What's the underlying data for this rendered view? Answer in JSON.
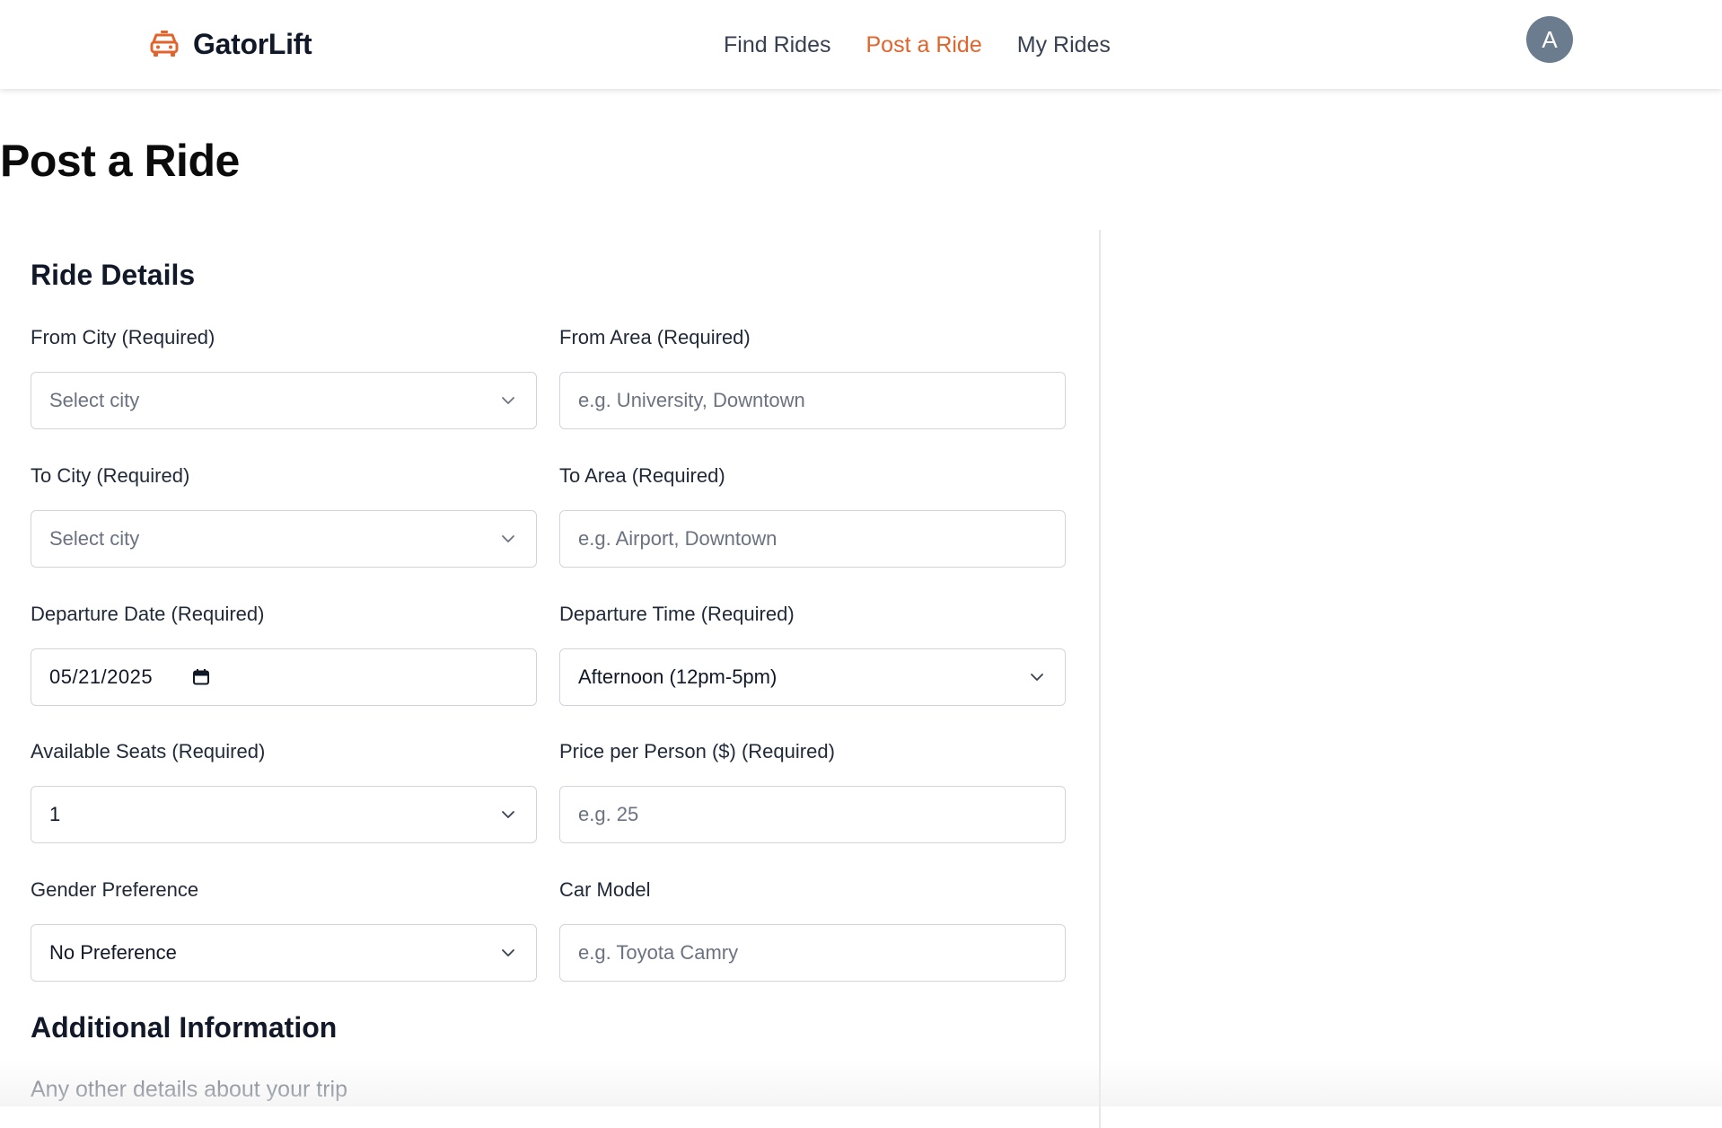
{
  "app": {
    "brand_name": "GatorLift",
    "brand_icon": "car-icon",
    "accent_color": "#e0642c"
  },
  "nav": {
    "links": [
      {
        "label": "Find Rides",
        "active": false
      },
      {
        "label": "Post a Ride",
        "active": true
      },
      {
        "label": "My Rides",
        "active": false
      }
    ],
    "avatar_letter": "A"
  },
  "page": {
    "title": "Post a Ride"
  },
  "form": {
    "ride_details_title": "Ride Details",
    "from_city": {
      "label": "From City (Required)",
      "value": "Select city",
      "is_placeholder": true
    },
    "from_area": {
      "label": "From Area (Required)",
      "placeholder": "e.g. University, Downtown",
      "value": ""
    },
    "to_city": {
      "label": "To City (Required)",
      "value": "Select city",
      "is_placeholder": true
    },
    "to_area": {
      "label": "To Area (Required)",
      "placeholder": "e.g. Airport, Downtown",
      "value": ""
    },
    "departure_date": {
      "label": "Departure Date (Required)",
      "value": "05/21/2025"
    },
    "departure_time": {
      "label": "Departure Time (Required)",
      "value": "Afternoon (12pm-5pm)"
    },
    "available_seats": {
      "label": "Available Seats (Required)",
      "value": "1"
    },
    "price": {
      "label": "Price per Person ($) (Required)",
      "placeholder": "e.g. 25",
      "value": ""
    },
    "gender_preference": {
      "label": "Gender Preference",
      "value": "No Preference"
    },
    "car_model": {
      "label": "Car Model",
      "placeholder": "e.g. Toyota Camry",
      "value": ""
    },
    "additional_info_title": "Additional Information",
    "additional_info_placeholder": "Any other details about your trip"
  }
}
